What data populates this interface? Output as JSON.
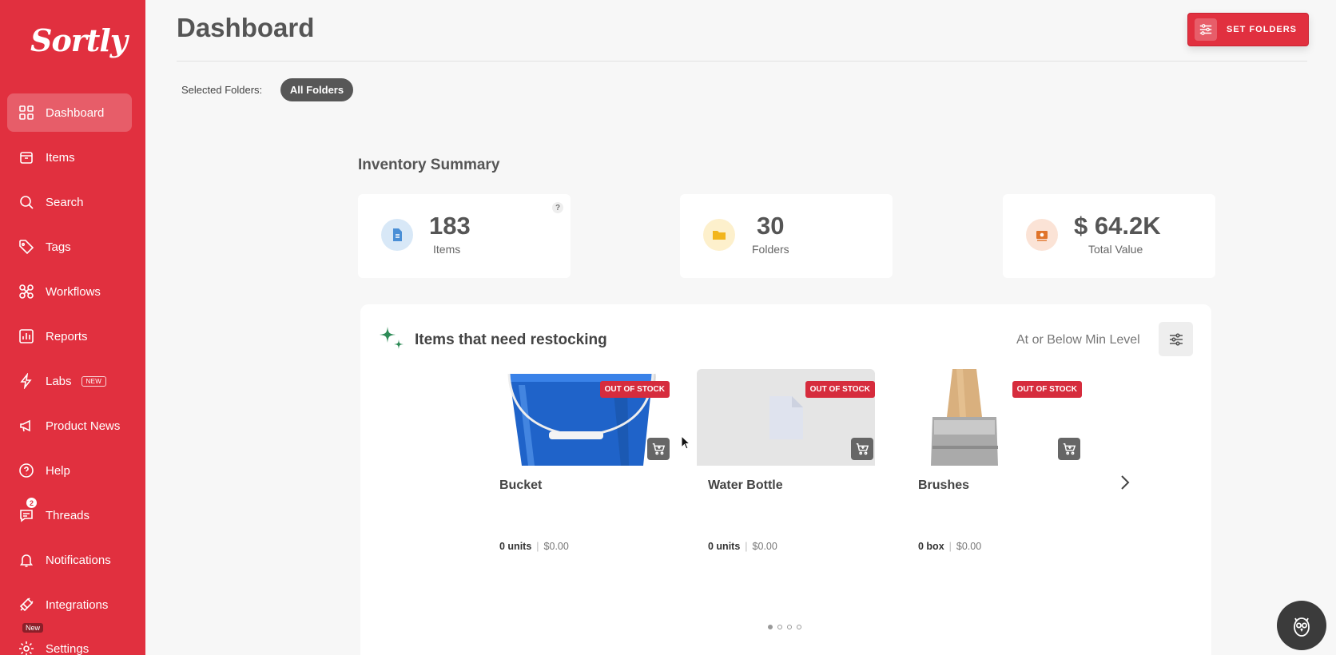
{
  "app": {
    "logo_text": "Sortly",
    "brand_color": "#e1303f"
  },
  "sidebar": {
    "items": [
      {
        "label": "Dashboard",
        "icon": "grid-icon",
        "active": true
      },
      {
        "label": "Items",
        "icon": "box-icon"
      },
      {
        "label": "Search",
        "icon": "search-icon"
      },
      {
        "label": "Tags",
        "icon": "tag-icon"
      },
      {
        "label": "Workflows",
        "icon": "workflows-icon"
      },
      {
        "label": "Reports",
        "icon": "reports-icon"
      },
      {
        "label": "Labs",
        "icon": "lightning-icon",
        "badge": "NEW"
      },
      {
        "label": "Product News",
        "icon": "megaphone-icon"
      },
      {
        "label": "Help",
        "icon": "help-icon"
      },
      {
        "label": "Threads",
        "icon": "chat-icon",
        "count": "2"
      },
      {
        "label": "Notifications",
        "icon": "bell-icon"
      },
      {
        "label": "Integrations",
        "icon": "plug-icon"
      },
      {
        "label": "Settings",
        "icon": "gear-icon",
        "badge": "New"
      }
    ]
  },
  "header": {
    "title": "Dashboard",
    "set_folders_label": "SET FOLDERS",
    "selected_folders_label": "Selected Folders:",
    "folder_chip": "All Folders"
  },
  "summary": {
    "title": "Inventory Summary",
    "cards": [
      {
        "value": "183",
        "label": "Items",
        "icon": "document-icon",
        "color": "#4a8fd6"
      },
      {
        "value": "30",
        "label": "Folders",
        "icon": "folder-icon",
        "color": "#f2b51d"
      },
      {
        "value": "$ 64.2K",
        "label": "Total Value",
        "icon": "money-icon",
        "color": "#e0742a"
      }
    ],
    "help": "?"
  },
  "restock": {
    "title": "Items that need restocking",
    "filter_label": "At or Below Min Level",
    "status_label": "OUT OF STOCK",
    "items": [
      {
        "name": "Bucket",
        "qty": "0 units",
        "price": "$0.00"
      },
      {
        "name": "Water Bottle",
        "qty": "0 units",
        "price": "$0.00"
      },
      {
        "name": "Brushes",
        "qty": "0 box",
        "price": "$0.00"
      }
    ],
    "pages": 4,
    "current_page": 1
  }
}
